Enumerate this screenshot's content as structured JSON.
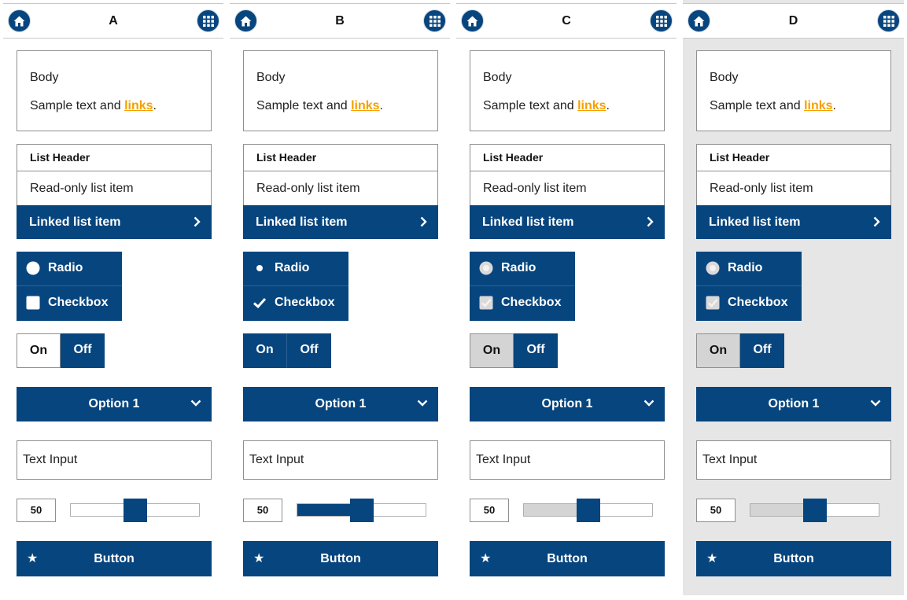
{
  "colors": {
    "primary": "#07457e",
    "link": "#f5a000",
    "border": "#8f8f8f",
    "disabled_fill": "#d4d4d4",
    "panel_d_background": "#e6e6e6"
  },
  "icons": {
    "home": "home-icon",
    "apps": "grid-icon",
    "list_chevron": "chevron-right-icon",
    "dropdown_chevron": "chevron-down-icon",
    "button": "star-icon"
  },
  "panels": [
    {
      "title": "A",
      "body": {
        "line1": "Body",
        "text_prefix": "Sample text and ",
        "link": "links",
        "text_suffix": "."
      },
      "list": {
        "header": "List Header",
        "readonly_item": "Read-only list item",
        "linked_item": "Linked list item"
      },
      "radio_label": "Radio",
      "checkbox_label": "Checkbox",
      "radio_state": "unchecked",
      "checkbox_state": "unchecked",
      "toggle": {
        "on": "On",
        "off": "Off",
        "selected": "Off"
      },
      "dropdown": {
        "value": "Option 1"
      },
      "text_input": {
        "value": "Text Input"
      },
      "slider": {
        "value": "50",
        "fraction": 0.5
      },
      "button": {
        "label": "Button"
      }
    },
    {
      "title": "B",
      "body": {
        "line1": "Body",
        "text_prefix": "Sample text and ",
        "link": "links",
        "text_suffix": "."
      },
      "list": {
        "header": "List Header",
        "readonly_item": "Read-only list item",
        "linked_item": "Linked list item"
      },
      "radio_label": "Radio",
      "checkbox_label": "Checkbox",
      "radio_state": "checked",
      "checkbox_state": "checked",
      "toggle": {
        "on": "On",
        "off": "Off",
        "selected": "both"
      },
      "dropdown": {
        "value": "Option 1"
      },
      "text_input": {
        "value": "Text Input"
      },
      "slider": {
        "value": "50",
        "fraction": 0.5
      },
      "button": {
        "label": "Button"
      }
    },
    {
      "title": "C",
      "body": {
        "line1": "Body",
        "text_prefix": "Sample text and ",
        "link": "links",
        "text_suffix": "."
      },
      "list": {
        "header": "List Header",
        "readonly_item": "Read-only list item",
        "linked_item": "Linked list item"
      },
      "radio_label": "Radio",
      "checkbox_label": "Checkbox",
      "radio_state": "disabled",
      "checkbox_state": "disabled",
      "toggle": {
        "on": "On",
        "off": "Off",
        "selected": "Off"
      },
      "dropdown": {
        "value": "Option 1"
      },
      "text_input": {
        "value": "Text Input"
      },
      "slider": {
        "value": "50",
        "fraction": 0.5
      },
      "button": {
        "label": "Button"
      }
    },
    {
      "title": "D",
      "body": {
        "line1": "Body",
        "text_prefix": "Sample text and ",
        "link": "links",
        "text_suffix": "."
      },
      "list": {
        "header": "List Header",
        "readonly_item": "Read-only list item",
        "linked_item": "Linked list item"
      },
      "radio_label": "Radio",
      "checkbox_label": "Checkbox",
      "radio_state": "disabled",
      "checkbox_state": "disabled",
      "toggle": {
        "on": "On",
        "off": "Off",
        "selected": "Off"
      },
      "dropdown": {
        "value": "Option 1"
      },
      "text_input": {
        "value": "Text Input"
      },
      "slider": {
        "value": "50",
        "fraction": 0.5
      },
      "button": {
        "label": "Button"
      }
    }
  ]
}
